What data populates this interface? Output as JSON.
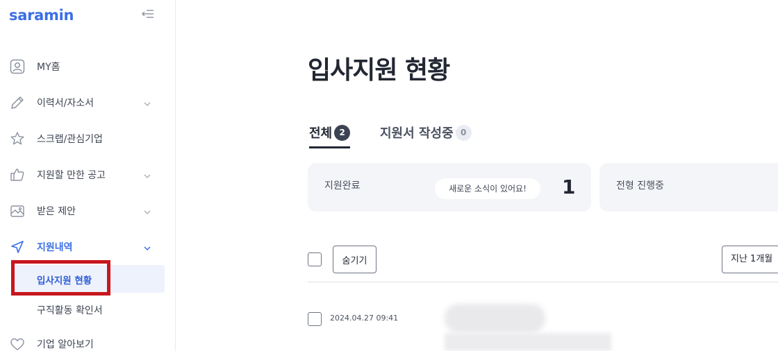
{
  "brand": {
    "logo_text": "saramin",
    "color": "#3b6fe6"
  },
  "sidebar": {
    "collapse_icon": "collapse-left-icon",
    "items": [
      {
        "label": "MY홈",
        "icon": "user-icon",
        "expandable": false
      },
      {
        "label": "이력서/자소서",
        "icon": "pencil-icon",
        "expandable": true
      },
      {
        "label": "스크랩/관심기업",
        "icon": "star-icon",
        "expandable": false
      },
      {
        "label": "지원할 만한 공고",
        "icon": "thumbs-up-icon",
        "expandable": true
      },
      {
        "label": "받은 제안",
        "icon": "mail-icon",
        "expandable": true
      },
      {
        "label": "지원내역",
        "icon": "send-icon",
        "expandable": true,
        "active": true
      },
      {
        "label": "기업 알아보기",
        "icon": "heart-icon",
        "expandable": false
      }
    ],
    "sub_items": [
      {
        "label": "입사지원 현황",
        "selected": true
      },
      {
        "label": "구직활동 확인서",
        "selected": false
      }
    ]
  },
  "main": {
    "title": "입사지원 현황",
    "tabs": [
      {
        "label": "전체",
        "count": "2"
      },
      {
        "label": "지원서 작성중",
        "count": "0"
      }
    ],
    "summary": [
      {
        "label": "지원완료",
        "badge": "새로운 소식이 있어요!",
        "value": "1"
      },
      {
        "label": "전형 진행중"
      }
    ],
    "list": {
      "hide_label": "숨기기",
      "period_label": "지난 1개월",
      "rows": [
        {
          "date": "2024.04.27 09:41"
        }
      ]
    }
  },
  "colors": {
    "accent": "#3b6fe6",
    "highlight_border": "#c8161d",
    "card_bg": "#f4f5f8"
  }
}
